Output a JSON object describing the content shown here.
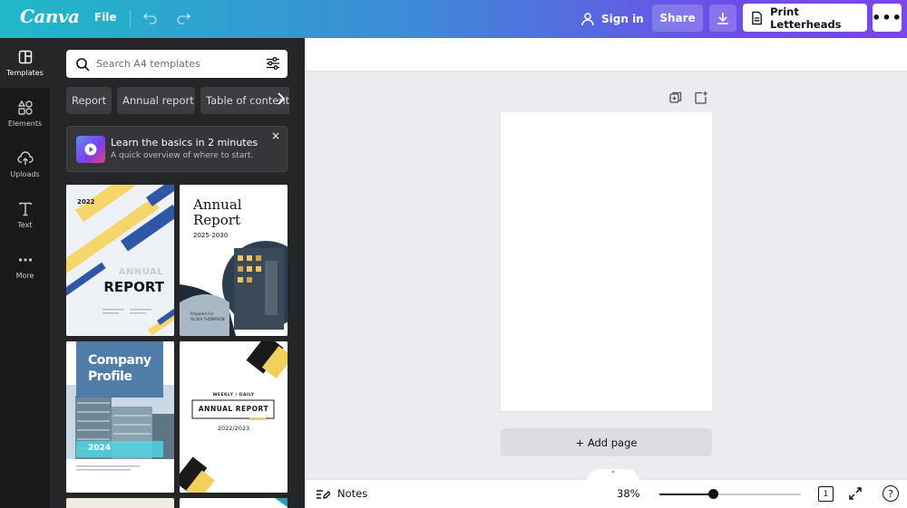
{
  "app": {
    "logo": "Canva",
    "file_menu": "File",
    "sign_in": "Sign in",
    "share": "Share",
    "print_button": "Print Letterheads",
    "more": "•••"
  },
  "rail": {
    "items": [
      {
        "label": "Templates",
        "icon": "templates-icon",
        "active": true
      },
      {
        "label": "Elements",
        "icon": "elements-icon"
      },
      {
        "label": "Uploads",
        "icon": "upload-icon"
      },
      {
        "label": "Text",
        "icon": "text-icon"
      },
      {
        "label": "More",
        "icon": "more-icon"
      }
    ]
  },
  "panel": {
    "search_placeholder": "Search A4 templates",
    "chips": [
      "Report",
      "Annual report",
      "Table of contents"
    ],
    "promo": {
      "title": "Learn the basics in 2 minutes",
      "subtitle": "A quick overview of where to start.",
      "close": "×"
    },
    "templates": [
      {
        "year": "2022",
        "title_light": "ANNUAL",
        "title_bold": "REPORT"
      },
      {
        "title_line1": "Annual",
        "title_line2": "Report",
        "years": "2025-2030",
        "prepared": "Prepared For",
        "name": "OLIVIA THOMPSON"
      },
      {
        "title_line1": "Company",
        "title_line2": "Profile",
        "year": "2024"
      },
      {
        "kicker": "WEEKLY / DAILY",
        "title": "ANNUAL REPORT",
        "years": "2022/2023"
      }
    ],
    "collapse_glyph": "‹"
  },
  "canvas": {
    "add_page": "+ Add page"
  },
  "footer": {
    "notes": "Notes",
    "zoom": "38%",
    "zoom_fraction": 0.38,
    "page_count": "1",
    "help": "?",
    "notch": "˄"
  },
  "colors": {
    "gradient_start": "#1fb9c8",
    "gradient_end": "#7b45ec",
    "panel_bg": "#252627",
    "rail_bg": "#18191b"
  }
}
